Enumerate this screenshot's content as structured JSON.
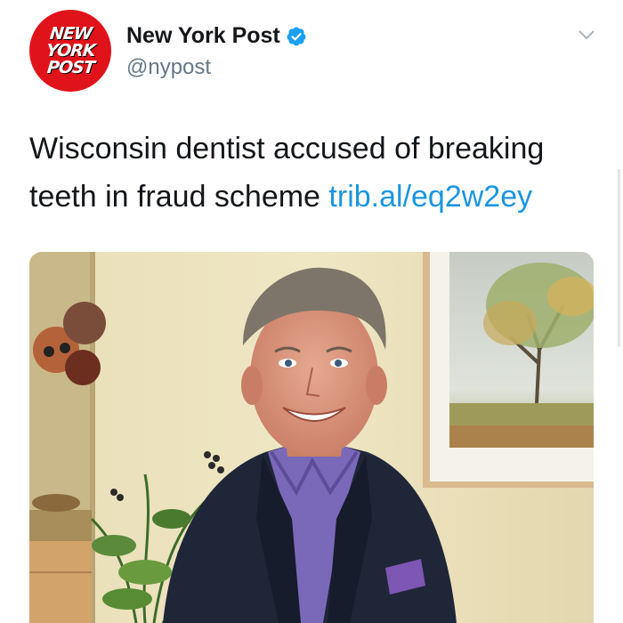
{
  "account": {
    "name": "New York Post",
    "handle": "@nypost",
    "logo_lines": [
      "NEW",
      "YORK",
      "POST"
    ],
    "verified": true
  },
  "tweet": {
    "text": "Wisconsin dentist accused of breaking teeth in fraud scheme ",
    "link": "trib.al/eq2w2ey"
  },
  "icons": [
    "verified-badge-icon",
    "chevron-down-icon"
  ],
  "colors": {
    "brand_red": "#e0131a",
    "link_blue": "#1b95e0",
    "verified_blue": "#1da1f2",
    "handle_gray": "#657786"
  }
}
